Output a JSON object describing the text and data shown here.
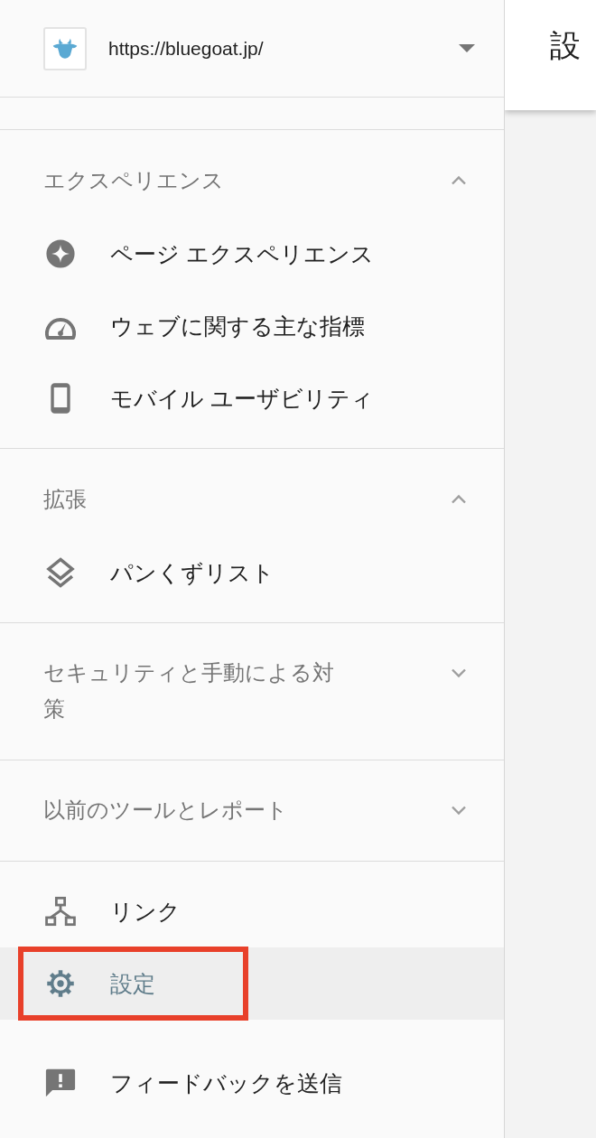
{
  "property_selector": {
    "url": "https://bluegoat.jp/"
  },
  "nav": [
    {
      "kind": "section",
      "title": "エクスペリエンス",
      "expanded": true,
      "items": [
        {
          "label": "ページ エクスペリエンス",
          "selected": false,
          "highlighted": false
        },
        {
          "label": "ウェブに関する主な指標",
          "selected": false,
          "highlighted": false
        },
        {
          "label": "モバイル ユーザビリティ",
          "selected": false,
          "highlighted": false
        }
      ]
    },
    {
      "kind": "section",
      "title": "拡張",
      "expanded": true,
      "items": [
        {
          "label": "パンくずリスト",
          "selected": false,
          "highlighted": false
        }
      ]
    },
    {
      "kind": "section",
      "title": "セキュリティと手動による対策",
      "expanded": false
    },
    {
      "kind": "section",
      "title": "以前のツールとレポート",
      "expanded": false
    },
    {
      "kind": "list",
      "items": [
        {
          "label": "リンク",
          "selected": false,
          "highlighted": false
        },
        {
          "label": "設定",
          "selected": true,
          "highlighted": true
        }
      ]
    },
    {
      "kind": "footer",
      "items": [
        {
          "label": "フィードバックを送信",
          "selected": false,
          "highlighted": false
        }
      ]
    }
  ],
  "page_header": {
    "title": "設"
  }
}
